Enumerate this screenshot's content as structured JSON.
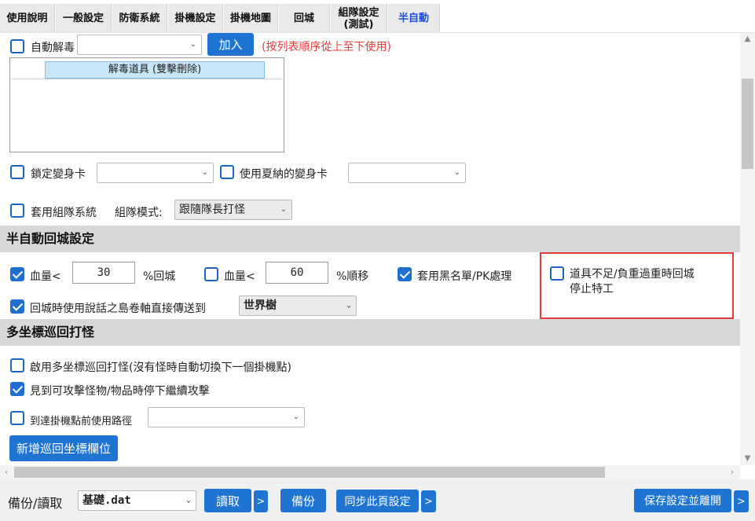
{
  "tabs": [
    {
      "label": "使用說明"
    },
    {
      "label": "一般設定"
    },
    {
      "label": "防衛系統"
    },
    {
      "label": "掛機設定"
    },
    {
      "label": "掛機地圖"
    },
    {
      "label": "回城"
    },
    {
      "label": "組隊設定\n(測試)"
    },
    {
      "label": "半自動"
    }
  ],
  "detox": {
    "checkbox_label": "自動解毒",
    "select_value": "",
    "add_button": "加入",
    "note": "(按列表順序從上至下使用)",
    "list_header": "解毒道具 (雙擊刪除)"
  },
  "transform": {
    "lock_label": "鎖定變身卡",
    "lock_value": "",
    "shana_label": "使用夏納的變身卡",
    "shana_value": ""
  },
  "party": {
    "label": "套用組隊系統",
    "mode_label": "組隊模式:",
    "mode_value": "跟隨隊長打怪"
  },
  "return_section": {
    "title": "半自動回城設定",
    "hp1_label": "血量<",
    "hp1_value": "30",
    "hp1_suffix": "%回城",
    "hp2_label": "血量<",
    "hp2_value": "60",
    "hp2_suffix": "%順移",
    "blacklist_label": "套用黑名單/PK處理",
    "item_shortage_label": "道具不足/負重過重時回城\n停止特工",
    "scroll_label": "回城時使用說話之島卷軸直接傳送到",
    "scroll_target": "世界樹"
  },
  "patrol_section": {
    "title": "多坐標巡回打怪",
    "enable_label": "啟用多坐標巡回打怪(沒有怪時自動切換下一個掛機點)",
    "stop_attack_label": "見到可攻擊怪物/物品時停下繼續攻擊",
    "path_label": "到達掛機點前使用路徑",
    "path_value": "",
    "add_button": "新增巡回坐標欄位"
  },
  "footer": {
    "backup_label": "備份/讀取",
    "file_value": "基礎.dat",
    "read_button": "讀取",
    "backup_button": "備份",
    "sync_button": "同步此頁設定",
    "save_button": "保存設定並離開",
    "more_symbol": ">"
  },
  "checked": {
    "detox": false,
    "lock": false,
    "shana": false,
    "party": false,
    "hp1": true,
    "hp2": false,
    "blacklist": true,
    "item_shortage": false,
    "scroll": true,
    "patrol": false,
    "stop_attack": true,
    "path": false
  }
}
